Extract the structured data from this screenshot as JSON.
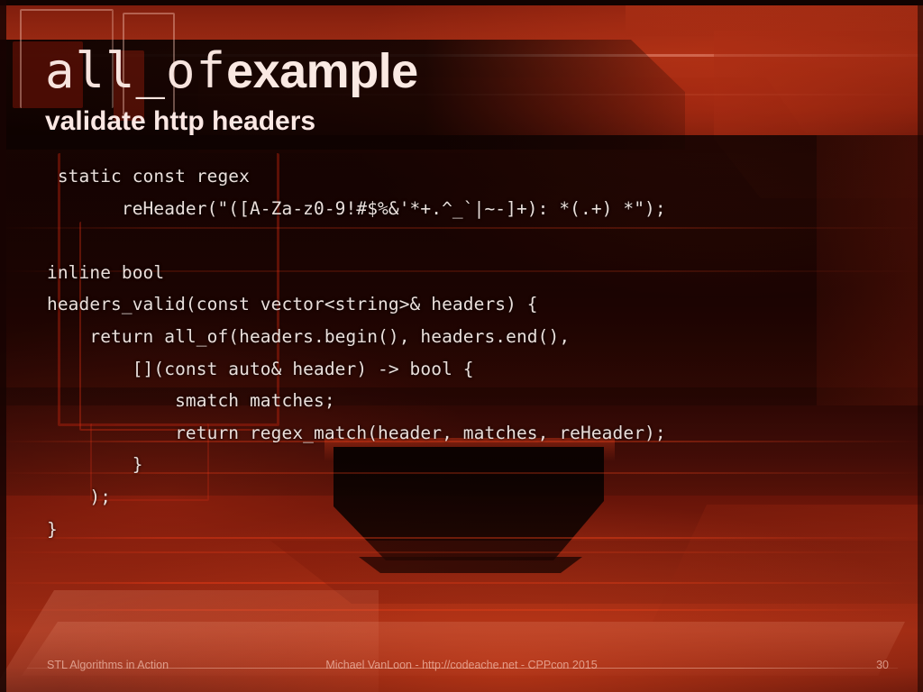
{
  "slide": {
    "title_mono": "all_of",
    "title_bold": "example",
    "subtitle": "validate http headers",
    "code_lines": [
      " static const regex",
      "       reHeader(\"([A-Za-z0-9!#$%&'*+.^_`|~-]+): *(.+) *\");",
      "",
      "inline bool",
      "headers_valid(const vector<string>& headers) {",
      "    return all_of(headers.begin(), headers.end(),",
      "        [](const auto& header) -> bool {",
      "            smatch matches;",
      "            return regex_match(header, matches, reHeader);",
      "        }",
      "    );",
      "}"
    ],
    "footer": {
      "left": "STL Algorithms in Action",
      "center": "Michael VanLoon - http://codeache.net - CPPcon 2015",
      "page_number": "30"
    },
    "colors": {
      "background_deep_red": "#7d1c0c",
      "background_dark": "#250503",
      "text_light": "#eadfdb",
      "title_light": "#f7e4de",
      "footer_text": "rgba(255,214,200,0.62)",
      "accent_scanline_red": "#ff3e16"
    }
  }
}
